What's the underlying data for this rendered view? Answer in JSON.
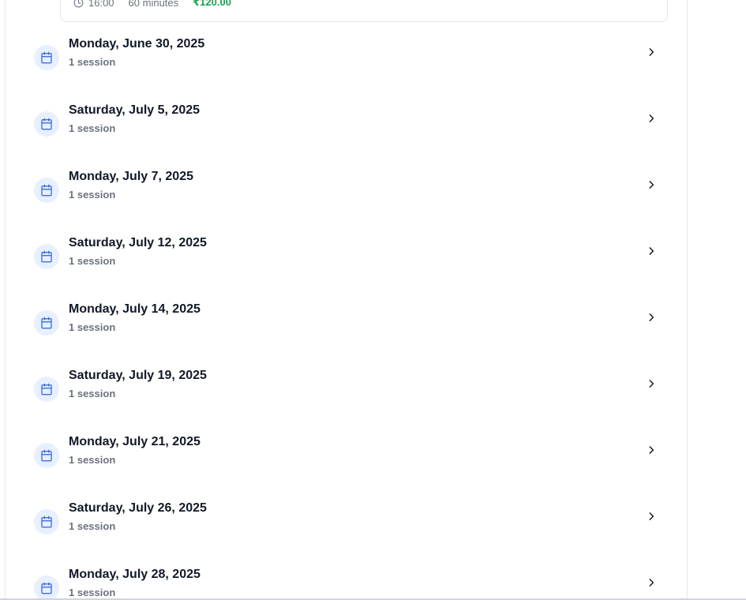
{
  "session_card": {
    "time": "16:00",
    "duration": "60 minutes",
    "price": "₹120.00"
  },
  "colors": {
    "accent": "#3b6fe0",
    "icon_bg": "#e8efff",
    "price": "#16a34a",
    "muted": "#6b7280"
  },
  "days": [
    {
      "title": "Monday, June 30, 2025",
      "count": "1 session"
    },
    {
      "title": "Saturday, July 5, 2025",
      "count": "1 session"
    },
    {
      "title": "Monday, July 7, 2025",
      "count": "1 session"
    },
    {
      "title": "Saturday, July 12, 2025",
      "count": "1 session"
    },
    {
      "title": "Monday, July 14, 2025",
      "count": "1 session"
    },
    {
      "title": "Saturday, July 19, 2025",
      "count": "1 session"
    },
    {
      "title": "Monday, July 21, 2025",
      "count": "1 session"
    },
    {
      "title": "Saturday, July 26, 2025",
      "count": "1 session"
    },
    {
      "title": "Monday, July 28, 2025",
      "count": "1 session"
    }
  ],
  "icons": {
    "day": "calendar-icon",
    "expand": "chevron-right-icon",
    "time": "clock-icon"
  }
}
